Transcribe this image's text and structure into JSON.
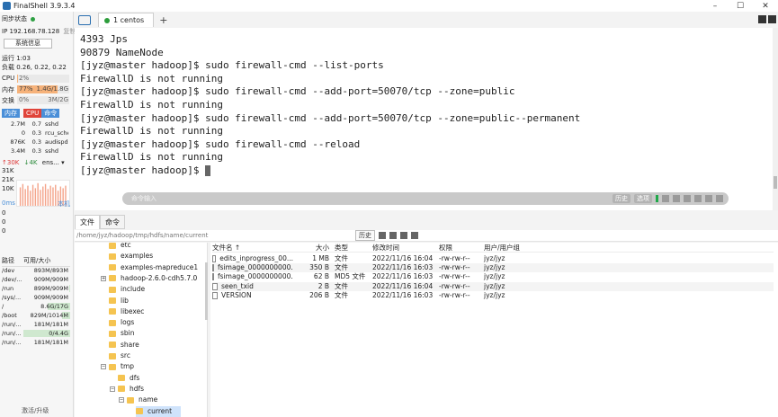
{
  "window": {
    "title": "FinalShell 3.9.3.4",
    "minimize": "–",
    "maximize": "☐",
    "close": "✕"
  },
  "left": {
    "sync_status": "同步状态",
    "sync_indicator_color": "#2ea043",
    "ip": "IP 192.168.78.128",
    "copy": "复制",
    "sys_info_button": "系统信息",
    "uptime": "运行 1:03",
    "load": "负载 0.26, 0.22, 0.22",
    "cpu_label": "CPU",
    "cpu_value": "2%",
    "cpu_fraction": 0.02,
    "mem_label": "内存",
    "mem_percent": "77%",
    "mem_fraction": 0.77,
    "mem_value": "1.4G/1.8G",
    "swap_label": "交换",
    "swap_percent": "0%",
    "swap_value": "3M/2G",
    "proc_tabs": [
      "内存",
      "CPU",
      "命令"
    ],
    "processes": [
      {
        "mem": "2.7M",
        "cpu": "0.7",
        "cmd": "sshd"
      },
      {
        "mem": "0",
        "cpu": "0.3",
        "cmd": "rcu_sche"
      },
      {
        "mem": "876K",
        "cpu": "0.3",
        "cmd": "audispd"
      },
      {
        "mem": "3.4M",
        "cpu": "0.3",
        "cmd": "sshd"
      }
    ],
    "net_up": "↑30K",
    "net_down": "↓4K",
    "net_iface": "ens...",
    "net_ticks": [
      "31K",
      "21K",
      "10K"
    ],
    "latency": "0ms",
    "latency_target": "本机",
    "latency_values": [
      "0",
      "0",
      "0"
    ],
    "disk_headers": [
      "路径",
      "可用/大小"
    ],
    "disks": [
      {
        "path": "/dev",
        "value": "893M/893M",
        "fraction": 0.0
      },
      {
        "path": "/dev/...",
        "value": "909M/909M",
        "fraction": 0.0
      },
      {
        "path": "/run",
        "value": "899M/909M",
        "fraction": 0.01
      },
      {
        "path": "/sys/...",
        "value": "909M/909M",
        "fraction": 0.0
      },
      {
        "path": "/",
        "value": "8.6G/17G",
        "fraction": 0.49
      },
      {
        "path": "/boot",
        "value": "829M/1014M",
        "fraction": 0.18
      },
      {
        "path": "/run/...",
        "value": "181M/181M",
        "fraction": 0.0
      },
      {
        "path": "/run/...",
        "value": "0/4.4G",
        "fraction": 1.0
      },
      {
        "path": "/run/...",
        "value": "181M/181M",
        "fraction": 0.0
      }
    ],
    "upgrade": "激活/升级"
  },
  "tabs": {
    "active_tab": "1 centos",
    "add": "+"
  },
  "terminal": {
    "lines": [
      "4393 Jps",
      "90879 NameNode",
      "[jyz@master hadoop]$ sudo firewall-cmd --list-ports",
      "FirewallD is not running",
      "[jyz@master hadoop]$ sudo firewall-cmd --add-port=50070/tcp --zone=public",
      "FirewallD is not running",
      "[jyz@master hadoop]$ sudo firewall-cmd --add-port=50070/tcp --zone=public--permanent",
      "FirewallD is not running",
      "[jyz@master hadoop]$ sudo firewall-cmd --reload",
      "FirewallD is not running",
      "[jyz@master hadoop]$ "
    ],
    "cmd_placeholder": "命令输入",
    "history_button": "历史",
    "options_button": "选项"
  },
  "bottom_tabs": [
    "文件",
    "命令"
  ],
  "pathbar": {
    "path": "/home/jyz/hadoop/tmp/hdfs/name/current",
    "history_button": "历史"
  },
  "tree": [
    {
      "name": "etc",
      "depth": 0
    },
    {
      "name": "examples",
      "depth": 0
    },
    {
      "name": "examples-mapreduce1",
      "depth": 0
    },
    {
      "name": "hadoop-2.6.0-cdh5.7.0",
      "depth": 0,
      "expander": "+"
    },
    {
      "name": "include",
      "depth": 0
    },
    {
      "name": "lib",
      "depth": 0
    },
    {
      "name": "libexec",
      "depth": 0
    },
    {
      "name": "logs",
      "depth": 0
    },
    {
      "name": "sbin",
      "depth": 0
    },
    {
      "name": "share",
      "depth": 0
    },
    {
      "name": "src",
      "depth": 0
    },
    {
      "name": "tmp",
      "depth": 0,
      "expander": "−"
    },
    {
      "name": "dfs",
      "depth": 1
    },
    {
      "name": "hdfs",
      "depth": 1,
      "expander": "−"
    },
    {
      "name": "name",
      "depth": 2,
      "expander": "−"
    },
    {
      "name": "current",
      "depth": 3,
      "selected": true
    }
  ],
  "file_headers": [
    "文件名 ↑",
    "大小",
    "类型",
    "修改时间",
    "权限",
    "用户/用户组"
  ],
  "files": [
    {
      "name": "edits_inprogress_00...",
      "size": "1 MB",
      "type": "文件",
      "mtime": "2022/11/16 16:04",
      "perm": "-rw-rw-r--",
      "owner": "jyz/jyz"
    },
    {
      "name": "fsimage_0000000000...",
      "size": "350 B",
      "type": "文件",
      "mtime": "2022/11/16 16:03",
      "perm": "-rw-rw-r--",
      "owner": "jyz/jyz"
    },
    {
      "name": "fsimage_0000000000...",
      "size": "62 B",
      "type": "MD5 文件",
      "mtime": "2022/11/16 16:03",
      "perm": "-rw-rw-r--",
      "owner": "jyz/jyz"
    },
    {
      "name": "seen_txid",
      "size": "2 B",
      "type": "文件",
      "mtime": "2022/11/16 16:04",
      "perm": "-rw-rw-r--",
      "owner": "jyz/jyz"
    },
    {
      "name": "VERSION",
      "size": "206 B",
      "type": "文件",
      "mtime": "2022/11/16 16:03",
      "perm": "-rw-rw-r--",
      "owner": "jyz/jyz"
    }
  ],
  "colors": {
    "accent": "#2a6fb0",
    "mem_bar": "#f6b27a",
    "cpu_tab": "#e0443a",
    "mem_tab": "#4a8fd8",
    "folder": "#f5c451",
    "net_bars": "#f4a48a"
  }
}
